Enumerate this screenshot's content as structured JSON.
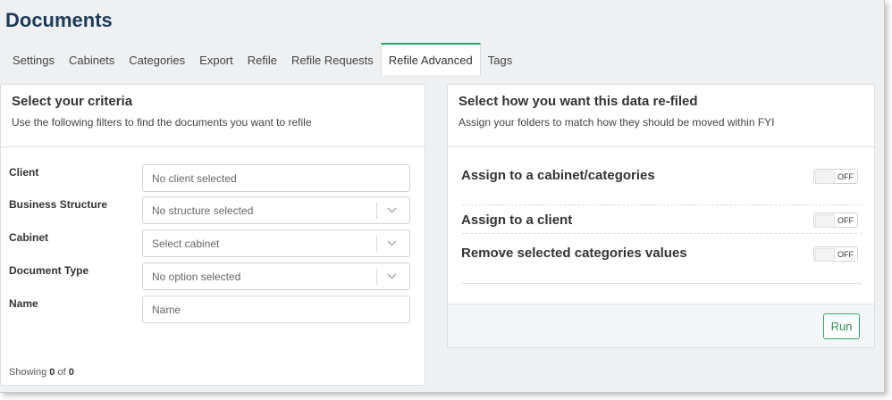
{
  "header": {
    "title": "Documents"
  },
  "tabs": [
    {
      "label": "Settings"
    },
    {
      "label": "Cabinets"
    },
    {
      "label": "Categories"
    },
    {
      "label": "Export"
    },
    {
      "label": "Refile"
    },
    {
      "label": "Refile Requests"
    },
    {
      "label": "Refile Advanced",
      "active": true
    },
    {
      "label": "Tags"
    }
  ],
  "criteria": {
    "title": "Select your criteria",
    "subtitle": "Use the following filters to find the documents you want to refile",
    "fields": [
      {
        "label": "Client",
        "placeholder": "No client selected"
      },
      {
        "label": "Business Structure",
        "placeholder": "No structure selected"
      },
      {
        "label": "Cabinet",
        "placeholder": "Select cabinet"
      },
      {
        "label": "Document Type",
        "placeholder": "No option selected"
      },
      {
        "label": "Name",
        "placeholder": "Name"
      }
    ],
    "showing_prefix": "Showing",
    "showing_count": "0",
    "showing_of": "of",
    "showing_total": "0"
  },
  "refile": {
    "title": "Select how you want this data re-filed",
    "subtitle": "Assign your folders to match how they should be moved within FYI",
    "options": [
      {
        "label": "Assign to a cabinet/categories",
        "toggle": "OFF"
      },
      {
        "label": "Assign to a client",
        "toggle": "OFF"
      },
      {
        "label": "Remove selected categories values",
        "toggle": "OFF"
      }
    ],
    "run_label": "Run"
  },
  "colors": {
    "accent": "#2fa866",
    "title": "#1f3a57"
  },
  "icons": {
    "dropdown": "chevron-down-icon"
  }
}
